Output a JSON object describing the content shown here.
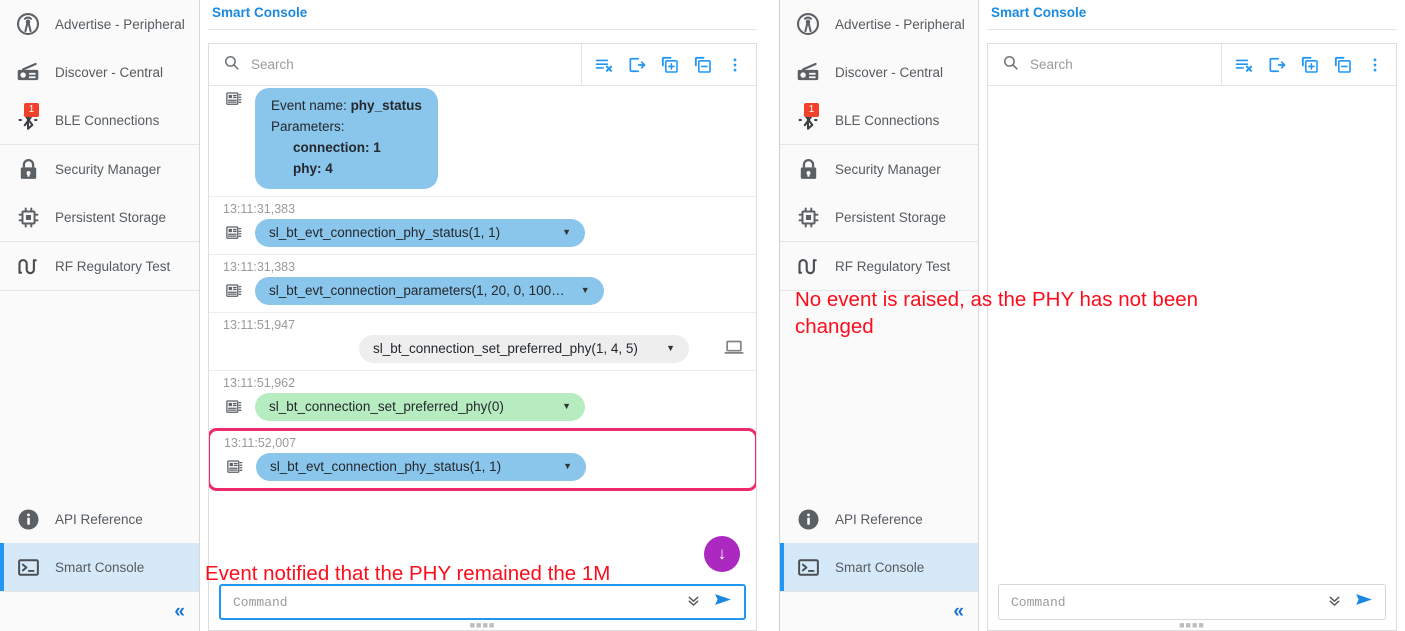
{
  "sidebar": {
    "groups": [
      {
        "items": [
          {
            "label": "Advertise - Peripheral",
            "icon": "advertise-icon",
            "badge": null,
            "active": false
          },
          {
            "label": "Discover - Central",
            "icon": "discover-radio-icon",
            "badge": null,
            "active": false
          },
          {
            "label": "BLE Connections",
            "icon": "bluetooth-icon",
            "badge": "1",
            "active": false
          }
        ]
      },
      {
        "items": [
          {
            "label": "Security Manager",
            "icon": "lock-icon",
            "badge": null,
            "active": false
          },
          {
            "label": "Persistent Storage",
            "icon": "chip-icon",
            "badge": null,
            "active": false
          }
        ]
      },
      {
        "items": [
          {
            "label": "RF Regulatory Test",
            "icon": "sine-wave-icon",
            "badge": null,
            "active": false
          }
        ]
      }
    ],
    "bottom_items": [
      {
        "label": "API Reference",
        "icon": "info-icon",
        "badge": null,
        "active": false
      },
      {
        "label": "Smart Console",
        "icon": "terminal-icon",
        "badge": null,
        "active": true
      }
    ],
    "collapse_label": "«"
  },
  "left_panel": {
    "title": "Smart Console",
    "search": {
      "placeholder": "Search",
      "value": ""
    },
    "toolbar_icons": [
      {
        "name": "clear-list-icon",
        "title": "Clear"
      },
      {
        "name": "export-icon",
        "title": "Export"
      },
      {
        "name": "copy-add-icon",
        "title": "Add to comparison"
      },
      {
        "name": "copy-remove-icon",
        "title": "Remove from comparison"
      },
      {
        "name": "more-vertical-icon",
        "title": "More options"
      }
    ],
    "expanded_event": {
      "line1_label": "Event name:",
      "line1_value": "phy_status",
      "line2_label": "Parameters:",
      "param1_label": "connection:",
      "param1_value": "1",
      "param2_label": "phy:",
      "param2_value": "4"
    },
    "rows": [
      {
        "timestamp": "13:11:31,383",
        "text": "sl_bt_evt_connection_phy_status(1, 1)",
        "kind": "event",
        "color": "blue",
        "highlighted": false,
        "has_caret": true,
        "has_laptop": false
      },
      {
        "timestamp": "13:11:31,383",
        "text": "sl_bt_evt_connection_parameters(1, 20, 0, 100…",
        "kind": "event",
        "color": "blue",
        "highlighted": false,
        "has_caret": true,
        "has_laptop": false
      },
      {
        "timestamp": "13:11:51,947",
        "text": "sl_bt_connection_set_preferred_phy(1, 4, 5)",
        "kind": "command",
        "color": "grey",
        "highlighted": false,
        "has_caret": true,
        "has_laptop": true
      },
      {
        "timestamp": "13:11:51,962",
        "text": "sl_bt_connection_set_preferred_phy(0)",
        "kind": "response",
        "color": "green",
        "highlighted": false,
        "has_caret": true,
        "has_laptop": false
      },
      {
        "timestamp": "13:11:52,007",
        "text": "sl_bt_evt_connection_phy_status(1, 1)",
        "kind": "event",
        "color": "blue",
        "highlighted": true,
        "has_caret": true,
        "has_laptop": false
      }
    ],
    "scroll_fab": {
      "name": "scroll-to-bottom-button",
      "glyph": "↓"
    },
    "command": {
      "placeholder": "Command",
      "value": ""
    },
    "annotation": "Event notified that the PHY remained the 1M"
  },
  "right_panel": {
    "title": "Smart Console",
    "search": {
      "placeholder": "Search",
      "value": ""
    },
    "toolbar_icons": [
      {
        "name": "clear-list-icon",
        "title": "Clear"
      },
      {
        "name": "export-icon",
        "title": "Export"
      },
      {
        "name": "copy-add-icon",
        "title": "Add to comparison"
      },
      {
        "name": "copy-remove-icon",
        "title": "Remove from comparison"
      },
      {
        "name": "more-vertical-icon",
        "title": "More options"
      }
    ],
    "rows": [],
    "command": {
      "placeholder": "Command",
      "value": ""
    },
    "annotation": "No event is raised, as the PHY has not been\nchanged"
  },
  "colors": {
    "accent_blue": "#2196f3",
    "title_blue": "#1b8ae0",
    "event_pill": "#8ac5ec",
    "response_pill": "#b6ecc0",
    "command_pill": "#eeeeee",
    "highlight_border": "#ef2a6b",
    "annotation_red": "#fc0d1b",
    "badge_red": "#f0422a",
    "fab_purple": "#ab28c1",
    "active_item_bg": "#d6e9f8"
  }
}
